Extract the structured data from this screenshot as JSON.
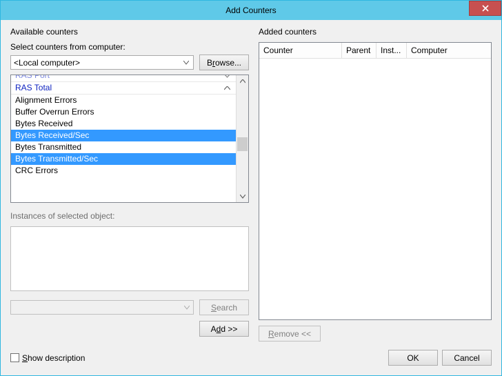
{
  "window": {
    "title": "Add Counters"
  },
  "left": {
    "section_label": "Available counters",
    "select_label": "Select counters from computer:",
    "computer_combo_text": "<Local computer>",
    "browse_pre": "B",
    "browse_mid": "r",
    "browse_post": "owse...",
    "instances_label": "Instances of selected object:",
    "search_pre": "",
    "search_mid": "S",
    "search_post": "earch",
    "add_pre": "A",
    "add_mid": "d",
    "add_post": "d >>"
  },
  "counters": {
    "ras_port": "RAS Port",
    "ras_total": "RAS Total",
    "c0": "Alignment Errors",
    "c1": "Buffer Overrun Errors",
    "c2": "Bytes Received",
    "c3": "Bytes Received/Sec",
    "c4": "Bytes Transmitted",
    "c5": "Bytes Transmitted/Sec",
    "c6": "CRC Errors"
  },
  "right": {
    "section_label": "Added counters",
    "col_counter": "Counter",
    "col_parent": "Parent",
    "col_inst": "Inst...",
    "col_computer": "Computer",
    "remove_pre": "",
    "remove_mid": "R",
    "remove_post": "emove <<"
  },
  "footer": {
    "show_desc_pre": "",
    "show_desc_mid": "S",
    "show_desc_post": "how description",
    "ok": "OK",
    "cancel": "Cancel"
  }
}
